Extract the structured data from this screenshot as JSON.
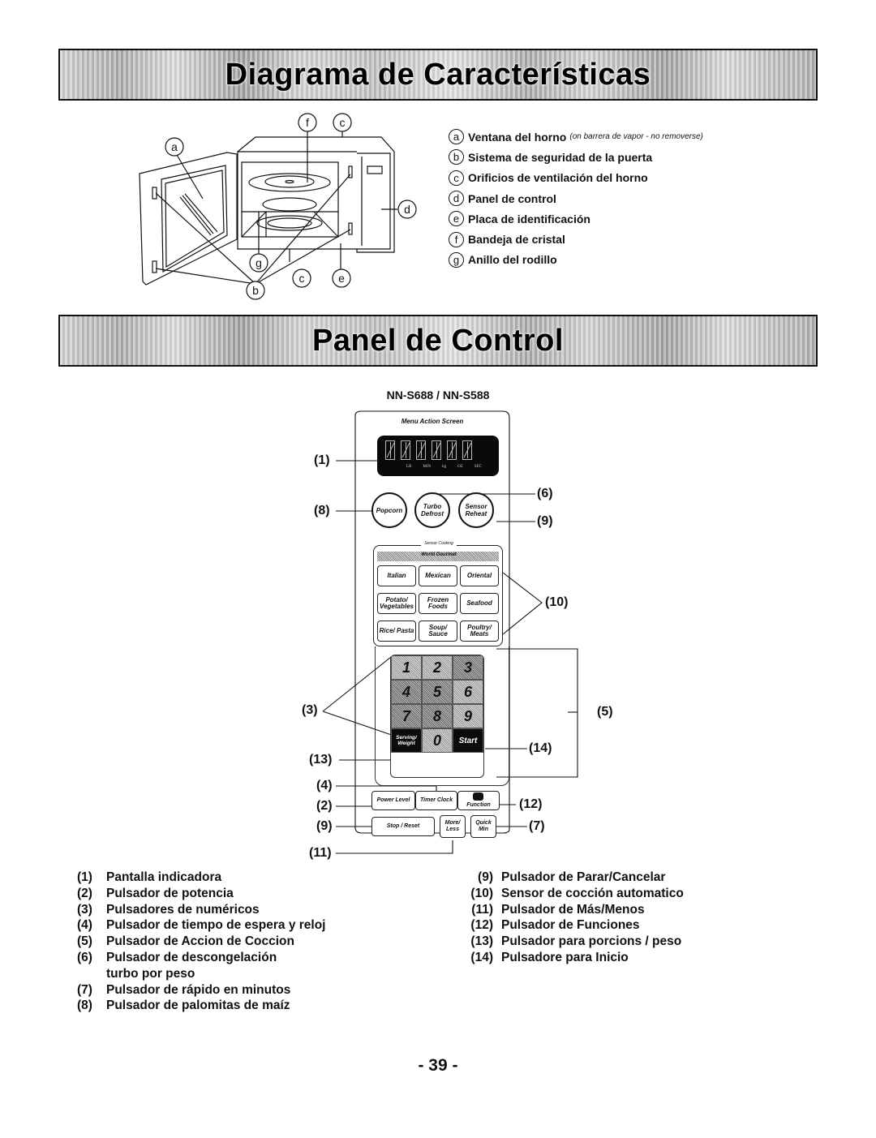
{
  "sections": {
    "features_title": "Diagrama de Características",
    "control_title": "Panel de Control"
  },
  "diagram": {
    "callouts": [
      "f",
      "c",
      "a",
      "d",
      "g",
      "b",
      "c",
      "e"
    ]
  },
  "legend": [
    {
      "letter": "a",
      "label": "Ventana del horno",
      "note": "(on barrera de vapor - no removerse)"
    },
    {
      "letter": "b",
      "label": "Sistema de seguridad de la puerta"
    },
    {
      "letter": "c",
      "label": "Orificios de ventilación del horno"
    },
    {
      "letter": "d",
      "label": "Panel de control"
    },
    {
      "letter": "e",
      "label": "Placa de identificación"
    },
    {
      "letter": "f",
      "label": "Bandeja de cristal"
    },
    {
      "letter": "g",
      "label": "Anillo del rodillo"
    }
  ],
  "model": "NN-S688 / NN-S588",
  "panel": {
    "screen_title": "Menu Action Screen",
    "display_units": [
      "LB",
      "MIN",
      "kg",
      "OZ",
      "SEC"
    ],
    "round_buttons": [
      "Popcorn",
      "Turbo Defrost",
      "Sensor Reheat"
    ],
    "sensor_caption": "Sensor Cooking",
    "world_caption": "World Gourmet",
    "menu_buttons": [
      "Italian",
      "Mexican",
      "Oriental",
      "Potato/ Vegetables",
      "Frozen Foods",
      "Seafood",
      "Rice/ Pasta",
      "Soup/ Sauce",
      "Poultry/ Meats"
    ],
    "keypad": [
      "1",
      "2",
      "3",
      "4",
      "5",
      "6",
      "7",
      "8",
      "9",
      "Serving/ Weight",
      "0",
      "Start"
    ],
    "bottom_buttons": {
      "power_level": "Power Level",
      "timer_clock": "Timer Clock",
      "function": "Function",
      "stop_reset": "Stop / Reset",
      "more_less": "More/ Less",
      "quick_min": "Quick Min"
    },
    "callouts": {
      "c1": "(1)",
      "c2": "(2)",
      "c3": "(3)",
      "c4": "(4)",
      "c5": "(5)",
      "c6": "(6)",
      "c7": "(7)",
      "c8": "(8)",
      "c9a": "(9)",
      "c9b": "(9)",
      "c10": "(10)",
      "c11": "(11)",
      "c12": "(12)",
      "c13": "(13)",
      "c14": "(14)"
    }
  },
  "descriptions_left": [
    {
      "num": "(1)",
      "text": "Pantalla indicadora"
    },
    {
      "num": "(2)",
      "text": "Pulsador de potencia"
    },
    {
      "num": "(3)",
      "text": "Pulsadores de numéricos"
    },
    {
      "num": "(4)",
      "text": "Pulsador de tiempo de espera y reloj"
    },
    {
      "num": "(5)",
      "text": "Pulsador de Accion de Coccion"
    },
    {
      "num": "(6)",
      "text": "Pulsador de descongelación"
    },
    {
      "num": "",
      "text": "turbo por peso"
    },
    {
      "num": "(7)",
      "text": "Pulsador de rápido en minutos"
    },
    {
      "num": "(8)",
      "text": "Pulsador de palomitas de maíz"
    }
  ],
  "descriptions_right": [
    {
      "num": "(9)",
      "text": "Pulsador de Parar/Cancelar"
    },
    {
      "num": "(10)",
      "text": "Sensor de cocción automatico"
    },
    {
      "num": "(11)",
      "text": "Pulsador de Más/Menos"
    },
    {
      "num": "(12)",
      "text": "Pulsador de Funciones"
    },
    {
      "num": "(13)",
      "text": "Pulsador para porcions / peso"
    },
    {
      "num": "(14)",
      "text": "Pulsadore para Inicio"
    }
  ],
  "page_number": "- 39 -"
}
